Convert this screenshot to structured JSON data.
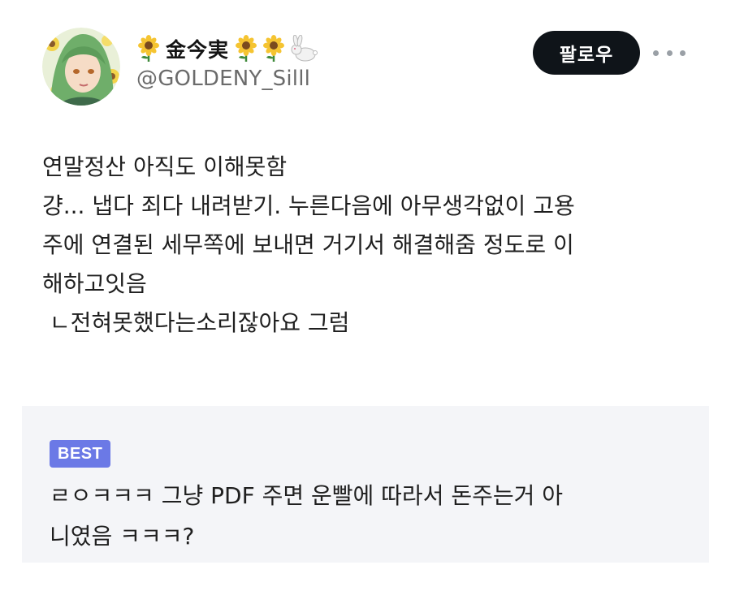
{
  "profile": {
    "display_name": "金今実",
    "handle": "@GOLDENY_Silll",
    "icons": [
      "sunflower-icon",
      "sunflower-icon",
      "sunflower-icon",
      "rabbit-icon"
    ],
    "avatar": "anime-character-avatar"
  },
  "actions": {
    "follow_label": "팔로우",
    "more_icon": "more-options-icon"
  },
  "tweet": {
    "lines": [
      "연말정산 아직도 이해못함",
      "걍... 냅다 죄다 내려받기. 누른다음에 아무생각없이 고용",
      "주에 연결된 세무쪽에 보내면 거기서 해결해줌 정도로 이",
      "해하고잇음",
      " ㄴ전혀못했다는소리잖아요 그럼"
    ]
  },
  "comment": {
    "badge": "BEST",
    "lines": [
      "ㄹㅇㅋㅋㅋ 그냥 PDF 주면 운빨에 따라서 돈주는거 아",
      "니였음 ㅋㅋㅋ?"
    ]
  },
  "colors": {
    "follow_bg": "#0f1419",
    "badge_bg": "#6b79e6",
    "comment_bg": "#f4f5f8",
    "handle": "#6b6b6b"
  }
}
